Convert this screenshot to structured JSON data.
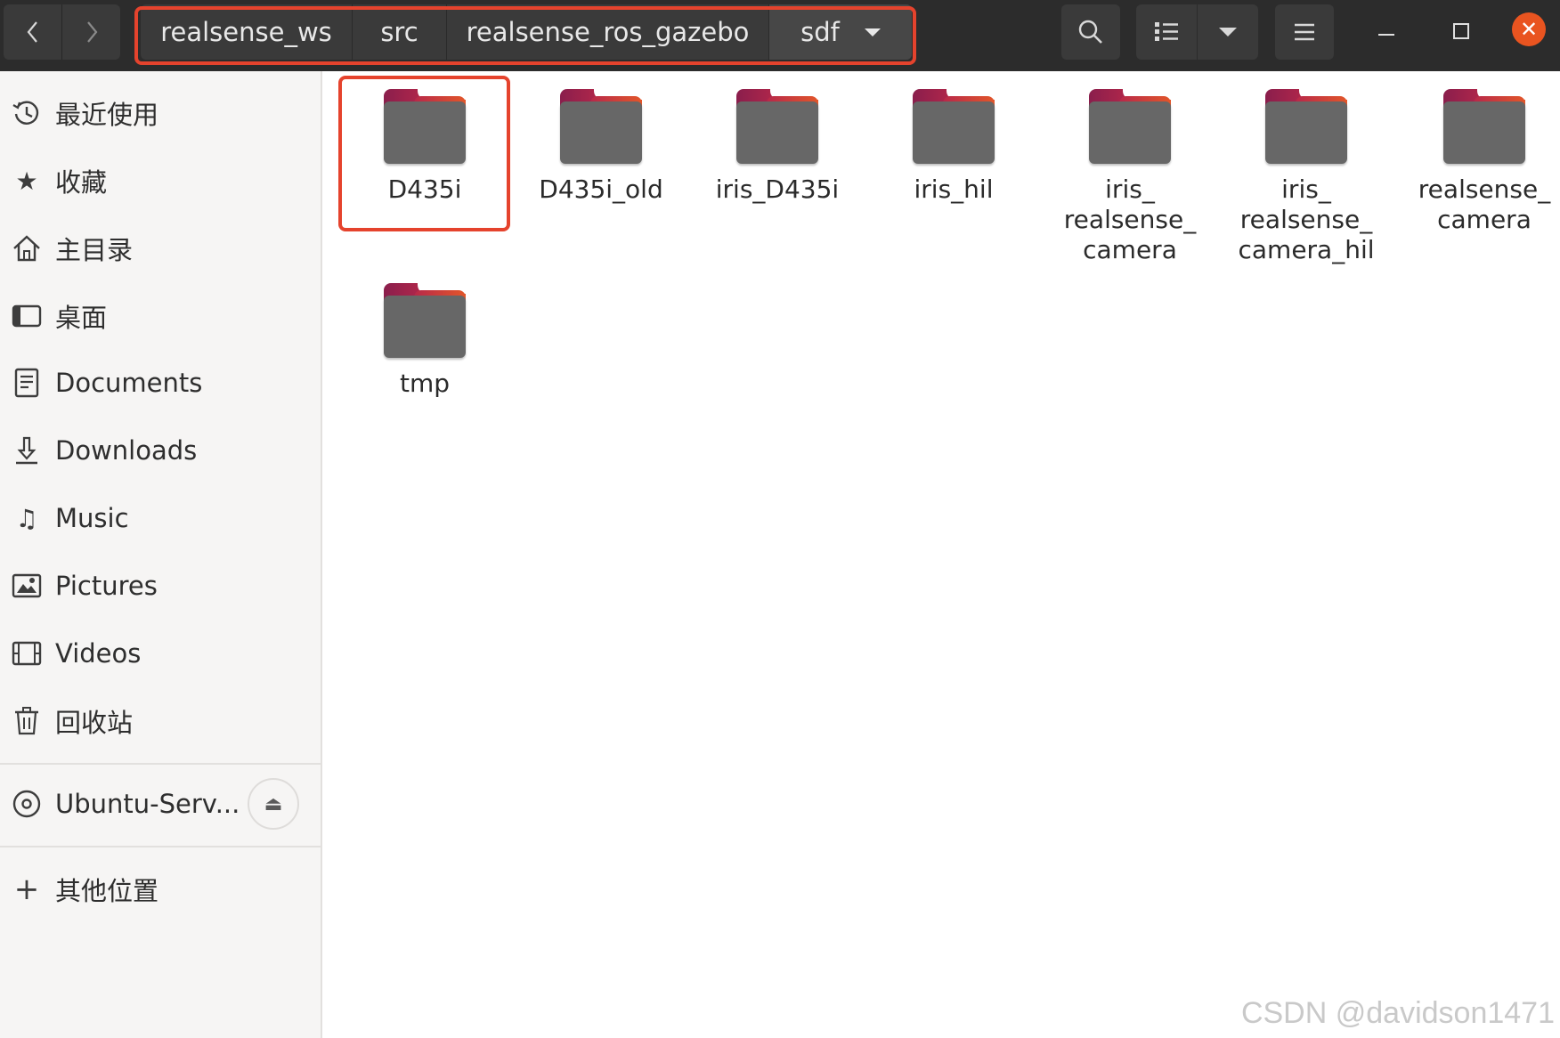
{
  "breadcrumb": [
    "realsense_ws",
    "src",
    "realsense_ros_gazebo",
    "sdf"
  ],
  "header_icons": {
    "back": "chevron-left-icon",
    "forward": "chevron-right-icon",
    "search": "search-icon",
    "view": "list-view-icon",
    "view_menu": "caret-down-icon",
    "menu": "hamburger-menu-icon",
    "minimize": "minimize-icon",
    "maximize": "maximize-icon",
    "close": "close-icon"
  },
  "sidebar": {
    "places": [
      {
        "label": "最近使用",
        "icon": "clock-icon"
      },
      {
        "label": "收藏",
        "icon": "star-icon"
      },
      {
        "label": "主目录",
        "icon": "home-icon"
      },
      {
        "label": "桌面",
        "icon": "desktop-icon"
      },
      {
        "label": "Documents",
        "icon": "document-icon"
      },
      {
        "label": "Downloads",
        "icon": "download-icon"
      },
      {
        "label": "Music",
        "icon": "music-icon"
      },
      {
        "label": "Pictures",
        "icon": "picture-icon"
      },
      {
        "label": "Videos",
        "icon": "video-icon"
      },
      {
        "label": "回收站",
        "icon": "trash-icon"
      }
    ],
    "device": {
      "label": "Ubuntu-Serv...",
      "icon": "disc-icon",
      "action_icon": "eject-icon"
    },
    "other": {
      "label": "其他位置",
      "icon": "plus-icon"
    }
  },
  "files": [
    {
      "name": "D435i",
      "selected": true
    },
    {
      "name": "D435i_old"
    },
    {
      "name": "iris_D435i"
    },
    {
      "name": "iris_hil"
    },
    {
      "name": "iris_\nrealsense_\ncamera"
    },
    {
      "name": "iris_\nrealsense_\ncamera_hil"
    },
    {
      "name": "realsense_\ncamera"
    },
    {
      "name": "tmp"
    }
  ],
  "colors": {
    "accent": "#e95420",
    "highlight": "#e5432d",
    "folder": "#676767"
  },
  "watermark": "CSDN @davidson1471"
}
